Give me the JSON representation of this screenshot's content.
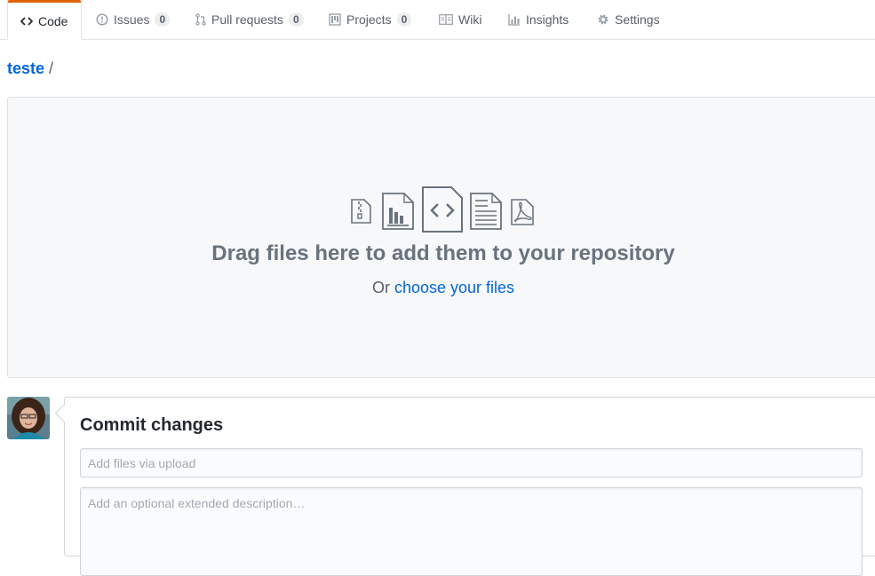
{
  "tabs": [
    {
      "label": "Code",
      "icon": "code-icon",
      "selected": true
    },
    {
      "label": "Issues",
      "icon": "issue-opened-icon",
      "count": "0"
    },
    {
      "label": "Pull requests",
      "icon": "git-pull-request-icon",
      "count": "0"
    },
    {
      "label": "Projects",
      "icon": "project-icon",
      "count": "0"
    },
    {
      "label": "Wiki",
      "icon": "book-icon"
    },
    {
      "label": "Insights",
      "icon": "graph-icon"
    },
    {
      "label": "Settings",
      "icon": "gear-icon"
    }
  ],
  "breadcrumb": {
    "repo": "teste",
    "separator": "/"
  },
  "dropzone": {
    "title": "Drag files here to add them to your repository",
    "prefix": "Or",
    "link": "choose your files",
    "icons": [
      "file-zip-icon",
      "file-chart-icon",
      "file-code-icon",
      "file-text-icon",
      "file-pdf-icon"
    ]
  },
  "commit": {
    "title": "Commit changes",
    "summary_placeholder": "Add files via upload",
    "description_placeholder": "Add an optional extended description…"
  },
  "colors": {
    "accent": "#e36209",
    "link": "#0366d6"
  }
}
